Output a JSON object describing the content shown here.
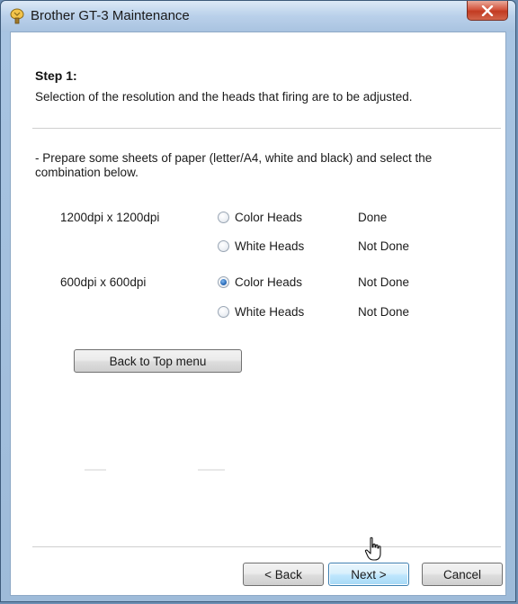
{
  "window": {
    "title": "Brother GT-3 Maintenance",
    "close_label": "x"
  },
  "step": {
    "title": "Step 1:",
    "description": "Selection of the resolution and the heads that firing are to be adjusted."
  },
  "instruction": "- Prepare some sheets of paper (letter/A4, white and black) and select the combination below.",
  "groups": [
    {
      "resolution": "1200dpi x 1200dpi",
      "options": [
        {
          "label": "Color Heads",
          "status": "Done",
          "checked": false
        },
        {
          "label": "White Heads",
          "status": "Not Done",
          "checked": false
        }
      ]
    },
    {
      "resolution": "600dpi x 600dpi",
      "options": [
        {
          "label": "Color Heads",
          "status": "Not Done",
          "checked": true
        },
        {
          "label": "White Heads",
          "status": "Not Done",
          "checked": false
        }
      ]
    }
  ],
  "buttons": {
    "back_to_top": "Back to Top menu",
    "back": "< Back",
    "next": "Next >",
    "cancel": "Cancel"
  },
  "colors": {
    "titlebar": "#b9d0ea",
    "close_button": "#c23b22",
    "next_button_border": "#3c7fb1"
  }
}
